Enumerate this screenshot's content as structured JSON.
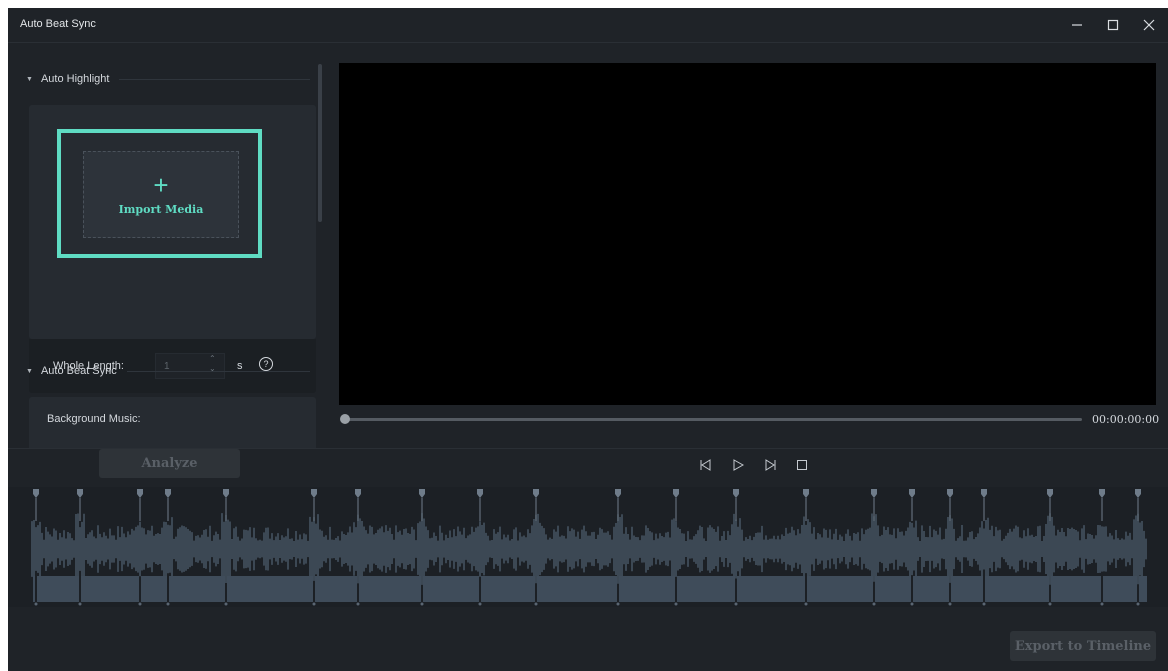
{
  "window": {
    "title": "Auto Beat Sync",
    "icons": [
      "minimize-icon",
      "maximize-icon",
      "close-icon"
    ]
  },
  "auto_highlight": {
    "section_title": "Auto Highlight",
    "import_label": "Import Media",
    "whole_length_label": "Whole Length:",
    "whole_length_value": "1",
    "unit": "s"
  },
  "auto_beat_sync": {
    "section_title": "Auto Beat Sync",
    "background_music_label": "Background Music:"
  },
  "player": {
    "time": "00:00:00:00",
    "progress": 0
  },
  "buttons": {
    "analyze": "Analyze",
    "export": "Export to Timeline"
  },
  "colors": {
    "accent": "#5fdcc3",
    "background": "#1f2328",
    "waveform": "#4a5968",
    "clip": "#3f4c5a"
  },
  "timeline": {
    "beat_count": 25
  }
}
